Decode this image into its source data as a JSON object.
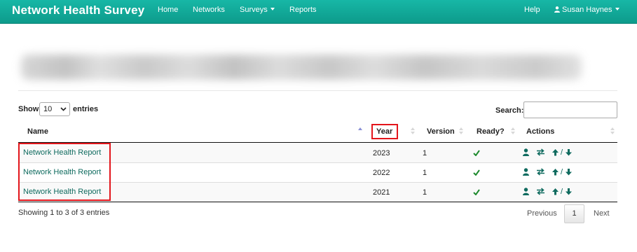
{
  "navbar": {
    "brand": "Network Health Survey",
    "links": [
      {
        "label": "Home"
      },
      {
        "label": "Networks"
      },
      {
        "label": "Surveys",
        "dropdown": true
      },
      {
        "label": "Reports"
      }
    ],
    "help": "Help",
    "user": "Susan Haynes",
    "colors": {
      "background": "#0e9f8f",
      "text": "#ffffff"
    }
  },
  "table_controls": {
    "show_label": "Show",
    "page_size": "10",
    "entries_label": "entries",
    "search_label": "Search:",
    "search_value": ""
  },
  "table": {
    "columns": [
      "Name",
      "Year",
      "Version",
      "Ready?",
      "Actions"
    ],
    "sorted_column": "Name",
    "rows": [
      {
        "name": "Network Health Report",
        "year": "2023",
        "version": "1",
        "ready": true
      },
      {
        "name": "Network Health Report",
        "year": "2022",
        "version": "1",
        "ready": true
      },
      {
        "name": "Network Health Report",
        "year": "2021",
        "version": "1",
        "ready": true
      }
    ],
    "action_icons": [
      "user-icon",
      "transfer-arrows-icon",
      "arrow-up-icon",
      "arrow-down-icon"
    ],
    "action_separator": "/",
    "link_color": "#0f6b5f",
    "check_color": "#1e8a2e"
  },
  "annotations": {
    "highlight_color": "#e3151b",
    "highlighted": [
      "year-header",
      "name-column-links"
    ]
  },
  "footer": {
    "info": "Showing 1 to 3 of 3 entries",
    "previous": "Previous",
    "current_page": "1",
    "next": "Next"
  }
}
